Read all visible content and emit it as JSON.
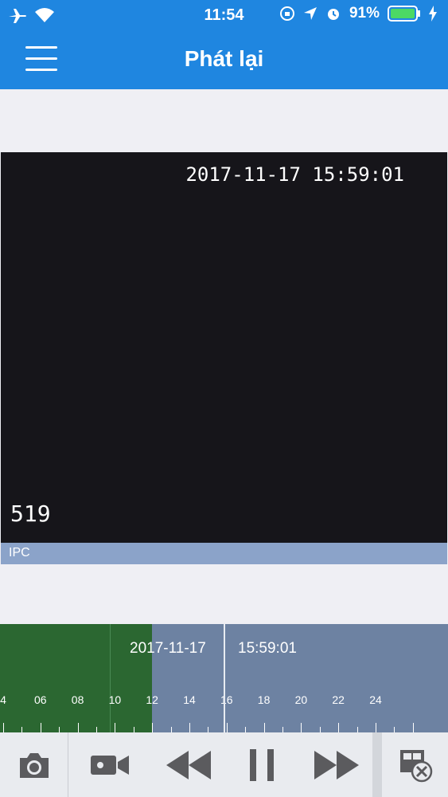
{
  "status_bar": {
    "time": "11:54",
    "battery": "91%"
  },
  "nav": {
    "title": "Phát lại"
  },
  "video": {
    "timestamp": "2017-11-17  15:59:01",
    "camera_label": "519"
  },
  "channel": {
    "name": "IPC"
  },
  "timeline": {
    "date": "2017-11-17",
    "clock": "15:59:01",
    "hour_labels": [
      "4",
      "06",
      "08",
      "10",
      "12",
      "14",
      "16",
      "18",
      "20",
      "22",
      "24"
    ],
    "recording_fraction": 0.1,
    "colors": {
      "recorded": "#2b6731",
      "empty": "#6d82a2"
    }
  },
  "icons": [
    "airplane-icon",
    "wifi-icon",
    "lock-rotation-icon",
    "location-icon",
    "alarm-icon",
    "battery-icon",
    "charging-icon",
    "menu-icon",
    "camera-icon",
    "video-record-icon",
    "rewind-icon",
    "pause-icon",
    "fast-forward-icon",
    "close-playback-icon"
  ],
  "colors": {
    "nav": "#1f86e0",
    "video_bg": "#16151a",
    "channel_bar": "#8ba3c9"
  }
}
